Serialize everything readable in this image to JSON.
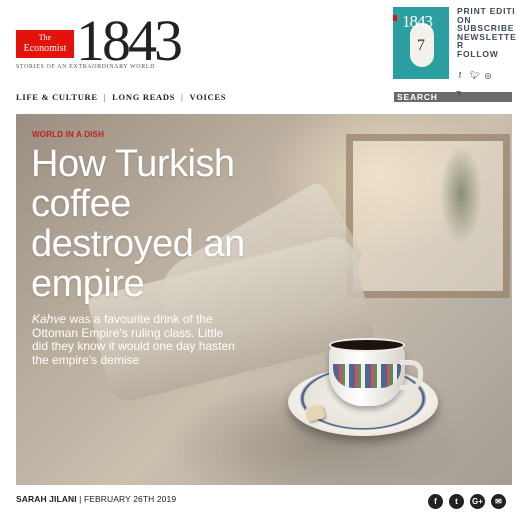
{
  "header": {
    "logo_line1": "The",
    "logo_line2": "Economist",
    "brand_number": "1843",
    "tagline": "STORIES OF AN EXTRAORDINARY WORLD",
    "nav": [
      "LIFE & CULTURE",
      "LONG READS",
      "VOICES"
    ],
    "cover_number": "1843",
    "cover_issue": "7",
    "side_links": [
      "PRINT EDITION",
      "SUBSCRIBE",
      "NEWSLETTER",
      "FOLLOW"
    ],
    "follow_icons": [
      "facebook-icon",
      "twitter-icon",
      "instagram-icon"
    ],
    "search_label": "SEARCH",
    "rss_icon": "rss-icon"
  },
  "article": {
    "kicker": "WORLD IN A DISH",
    "headline": "How Turkish coffee destroyed an empire",
    "standfirst_italic": "Kahve",
    "standfirst_rest": " was a favourite drink of the Ottoman Empire’s ruling class. Little did they know it would one day hasten the empire’s demise",
    "author": "SARAH JILANI",
    "date": "FEBRUARY 26TH 2019"
  },
  "share": [
    {
      "name": "facebook-share-icon",
      "glyph": "f"
    },
    {
      "name": "twitter-share-icon",
      "glyph": "t"
    },
    {
      "name": "googleplus-share-icon",
      "glyph": "G+"
    },
    {
      "name": "email-share-icon",
      "glyph": "✉"
    }
  ],
  "colors": {
    "brand_red": "#e3120b",
    "kicker_red": "#c01f1a",
    "side_link_blue": "#3d4a5c",
    "cover_teal": "#2a9ea0"
  }
}
